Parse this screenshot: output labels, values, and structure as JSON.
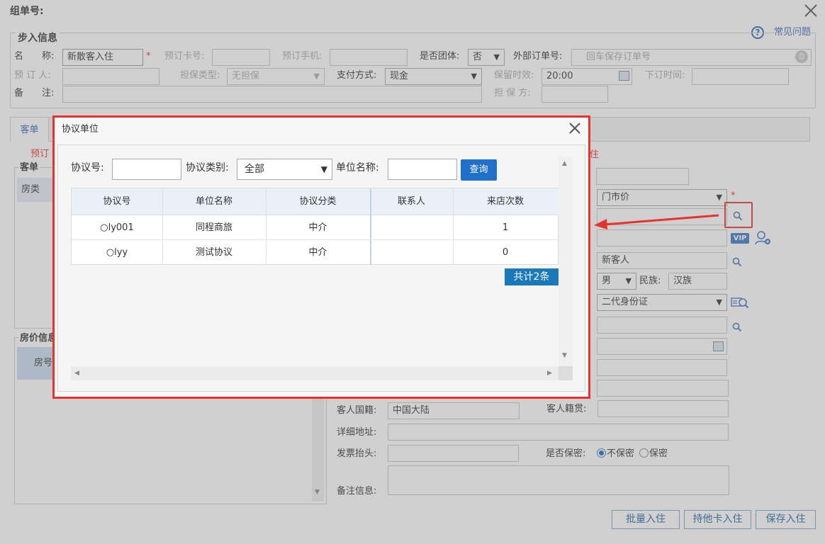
{
  "window": {
    "title": "组单号:"
  },
  "help": {
    "label": "常见问题"
  },
  "step": {
    "section_title": "步入信息",
    "name_label": "名　　称:",
    "name_value": "新散客入住",
    "reserve_card_label": "预订卡号:",
    "reserve_phone_label": "预订手机:",
    "is_group_label": "是否团体:",
    "is_group_value": "否",
    "external_order_label": "外部订单号:",
    "external_order_placeholder": "回车保存订单号",
    "external_badge": "0",
    "booker_label": "预 订 人:",
    "guarantee_type_label": "担保类型:",
    "guarantee_type_value": "无担保",
    "payment_label": "支付方式:",
    "payment_value": "现金",
    "hold_label": "保留时效:",
    "hold_value": "20:00",
    "next_order_label": "下订时间:",
    "remark_label": "备　　注:",
    "guarantor_label": "担 保 方:"
  },
  "tabs": {
    "guest": "客单"
  },
  "left": {
    "guest_section": "客单",
    "room_type_label": "房类",
    "price_section": "房价信息",
    "room_no": "房号",
    "reserve_partial": "预订"
  },
  "right": {
    "price_select": "门市价",
    "vip_badge": "VIP",
    "guest_name": "新客人",
    "gender": "男",
    "ethnicity_label": "民族:",
    "ethnicity_value": "汉族",
    "id_type": "二代身份证",
    "nationality_label": "客人国籍:",
    "nationality_value": "中国大陆",
    "native_place_label": "客人籍贯:",
    "address_label": "详细地址:",
    "invoice_label": "发票抬头:",
    "confidential_label": "是否保密:",
    "not_confidential": "不保密",
    "confidential": "保密",
    "notes_label": "备注信息:",
    "partial_label": "住"
  },
  "footer": {
    "batch_checkin": "批量入住",
    "other_card_checkin": "持他卡入住",
    "save_checkin": "保存入住"
  },
  "dialog": {
    "title": "协议单位",
    "agreement_no_label": "协议号:",
    "category_label": "协议类别:",
    "category_value": "全部",
    "unit_name_label": "单位名称:",
    "query_button": "查询",
    "columns": [
      "协议号",
      "单位名称",
      "协议分类",
      "联系人",
      "来店次数"
    ],
    "rows": [
      {
        "no": "ly001",
        "name": "同程商旅",
        "category": "中介",
        "contact": "",
        "visits": "1"
      },
      {
        "no": "lyy",
        "name": "测试协议",
        "category": "中介",
        "contact": "",
        "visits": "0"
      }
    ],
    "total": "共计2条"
  },
  "colors": {
    "highlight": "#e8322d",
    "accent": "#1c6bbd",
    "header_bg": "#e9f0f8"
  }
}
